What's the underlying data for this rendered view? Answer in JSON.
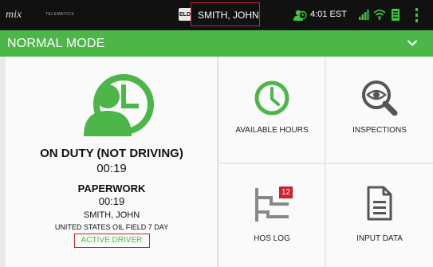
{
  "statusbar": {
    "logo_text": "mix",
    "logo_sub": "TELEMATICS",
    "eld_badge": "ELD",
    "driver_name": "SMITH, JOHN",
    "time": "4:01 EST"
  },
  "modebar": {
    "title": "NORMAL MODE"
  },
  "status_panel": {
    "duty_status": "ON DUTY (NOT DRIVING)",
    "duty_time": "00:19",
    "activity": "PAPERWORK",
    "activity_time": "00:19",
    "driver": "SMITH, JOHN",
    "ruleset": "UNITED STATES OIL FIELD 7 DAY",
    "driver_role": "ACTIVE DRIVER"
  },
  "tiles": {
    "available_hours": "AVAILABLE HOURS",
    "inspections": "INSPECTIONS",
    "hos_log": "HOS LOG",
    "hos_log_badge": "12",
    "input_data": "INPUT DATA"
  },
  "colors": {
    "brand_green": "#4cb648",
    "status_green": "#3ec73e",
    "highlight_red": "#d0202c",
    "badge_red": "#d0202c"
  }
}
